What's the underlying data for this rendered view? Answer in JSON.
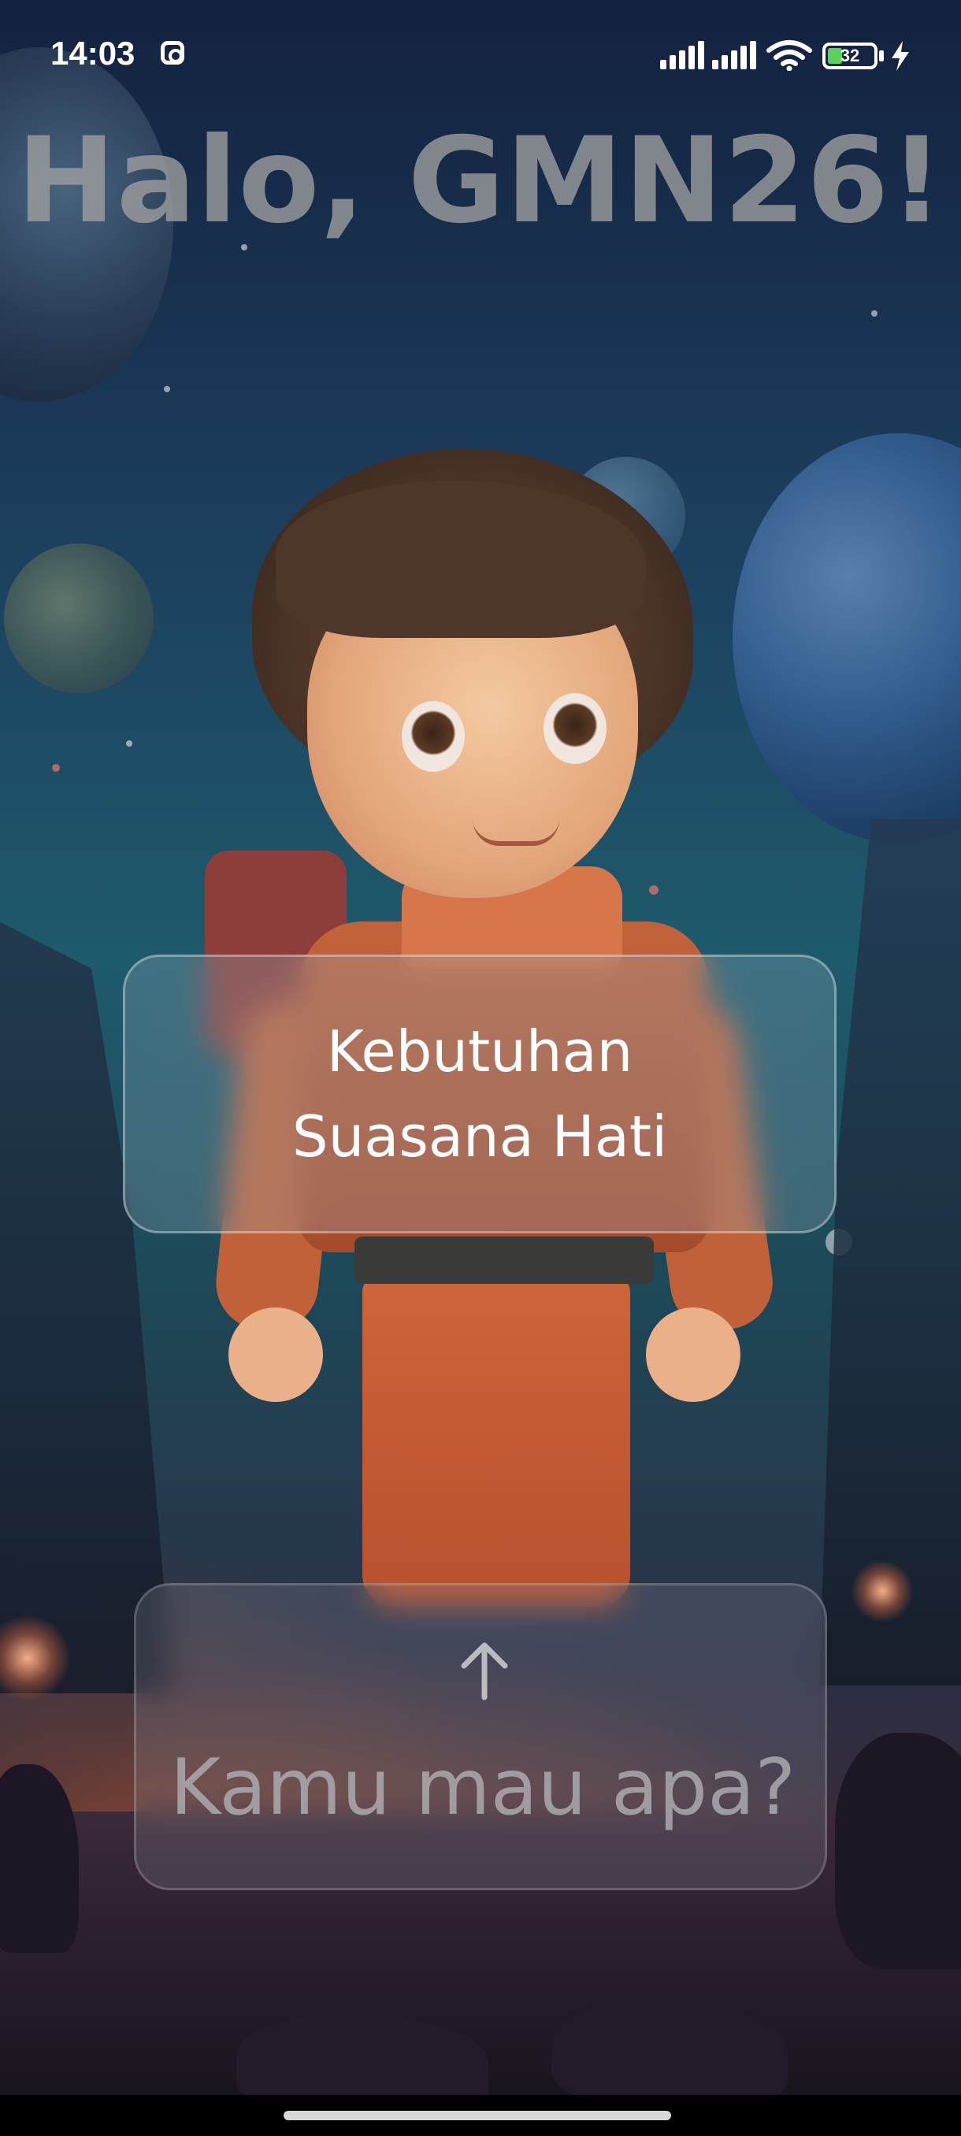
{
  "status_bar": {
    "time": "14:03",
    "battery_level": 32,
    "battery_text": "32",
    "icons": [
      "instagram-icon",
      "signal-icon",
      "signal-icon",
      "wifi-icon",
      "battery-icon",
      "charging-icon"
    ]
  },
  "greeting": {
    "text": "Halo, GMN26!"
  },
  "mood_card": {
    "line1": "Kebutuhan",
    "line2": "Suasana Hati"
  },
  "request_card": {
    "icon": "arrow-up-icon",
    "text": "Kamu mau apa?"
  }
}
